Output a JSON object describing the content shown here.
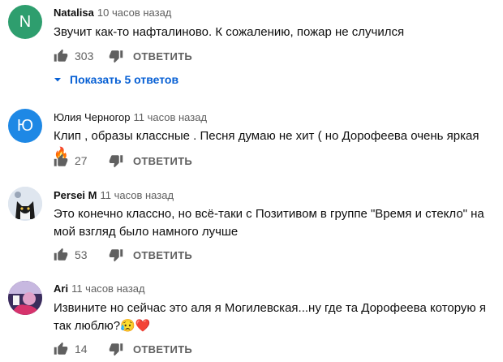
{
  "comments": [
    {
      "avatar_letter": "N",
      "avatar_color": "#2e9e6e",
      "author": "Natalisa",
      "time": "10 часов назад",
      "text": "Звучит как-то нафталиново. К сожалению, пожар не случился",
      "likes": "303",
      "reply_label": "ОТВЕТИТЬ"
    },
    {
      "avatar_letter": "Ю",
      "avatar_color": "#1e88e5",
      "author": "Юлия Черногор",
      "time": "11 часов назад",
      "text": "Клип , образы классные . Песня думаю не хит ( но Дорофеева очень яркая 🔥",
      "likes": "27",
      "reply_label": "ОТВЕТИТЬ"
    },
    {
      "avatar_letter": "",
      "avatar_color": "#c9d6e8",
      "author": "Persei M",
      "time": "11 часов назад",
      "text": "Это конечно классно, но всё-таки с Позитивом в группе \"Время и стекло\" на мой взгляд было намного лучше",
      "likes": "53",
      "reply_label": "ОТВЕТИТЬ"
    },
    {
      "avatar_letter": "",
      "avatar_color": "#8a4fb0",
      "author": "Ari",
      "time": "11 часов назад",
      "text": "Извините но сейчас это аля я Могилевская...ну где та Дорофеева которую я так люблю?😥❤️",
      "likes": "14",
      "reply_label": "ОТВЕТИТЬ"
    }
  ],
  "replies_toggle": {
    "label": "Показать 5 ответов",
    "icon": "caret-down-icon"
  },
  "colors": {
    "link": "#065fd4",
    "secondary": "#606060"
  }
}
